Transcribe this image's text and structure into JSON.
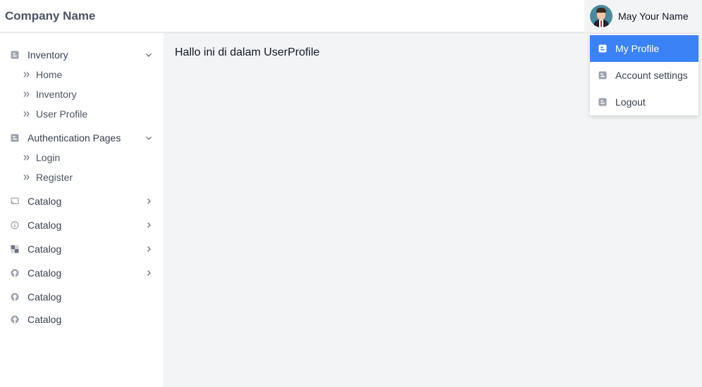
{
  "header": {
    "brand": "Company Name",
    "user_name": "May Your Name"
  },
  "sidebar": {
    "groups": [
      {
        "label": "Inventory",
        "icon": "blogger-icon",
        "expanded": true,
        "items": [
          {
            "label": "Home"
          },
          {
            "label": "Inventory"
          },
          {
            "label": "User Profile"
          }
        ]
      },
      {
        "label": "Authentication Pages",
        "icon": "blogger-icon",
        "expanded": true,
        "items": [
          {
            "label": "Login"
          },
          {
            "label": "Register"
          }
        ]
      }
    ],
    "catalog": [
      {
        "label": "Catalog",
        "icon": "cast-icon",
        "has_chevron": true
      },
      {
        "label": "Catalog",
        "icon": "info-icon",
        "has_chevron": true
      },
      {
        "label": "Catalog",
        "icon": "checker-icon",
        "has_chevron": true
      },
      {
        "label": "Catalog",
        "icon": "github-icon",
        "has_chevron": true
      },
      {
        "label": "Catalog",
        "icon": "github-icon",
        "has_chevron": false
      },
      {
        "label": "Catalog",
        "icon": "github-icon",
        "has_chevron": false
      }
    ]
  },
  "main": {
    "text": "Hallo ini di dalam UserProfile"
  },
  "user_menu": {
    "items": [
      {
        "label": "My Profile",
        "icon": "blogger-icon",
        "active": true
      },
      {
        "label": "Account settings",
        "icon": "blogger-icon",
        "active": false
      },
      {
        "label": "Logout",
        "icon": "blogger-icon",
        "active": false
      }
    ]
  },
  "colors": {
    "accent": "#3b82f6",
    "page_bg": "#f3f4f6",
    "sidebar_bg": "#ffffff"
  }
}
